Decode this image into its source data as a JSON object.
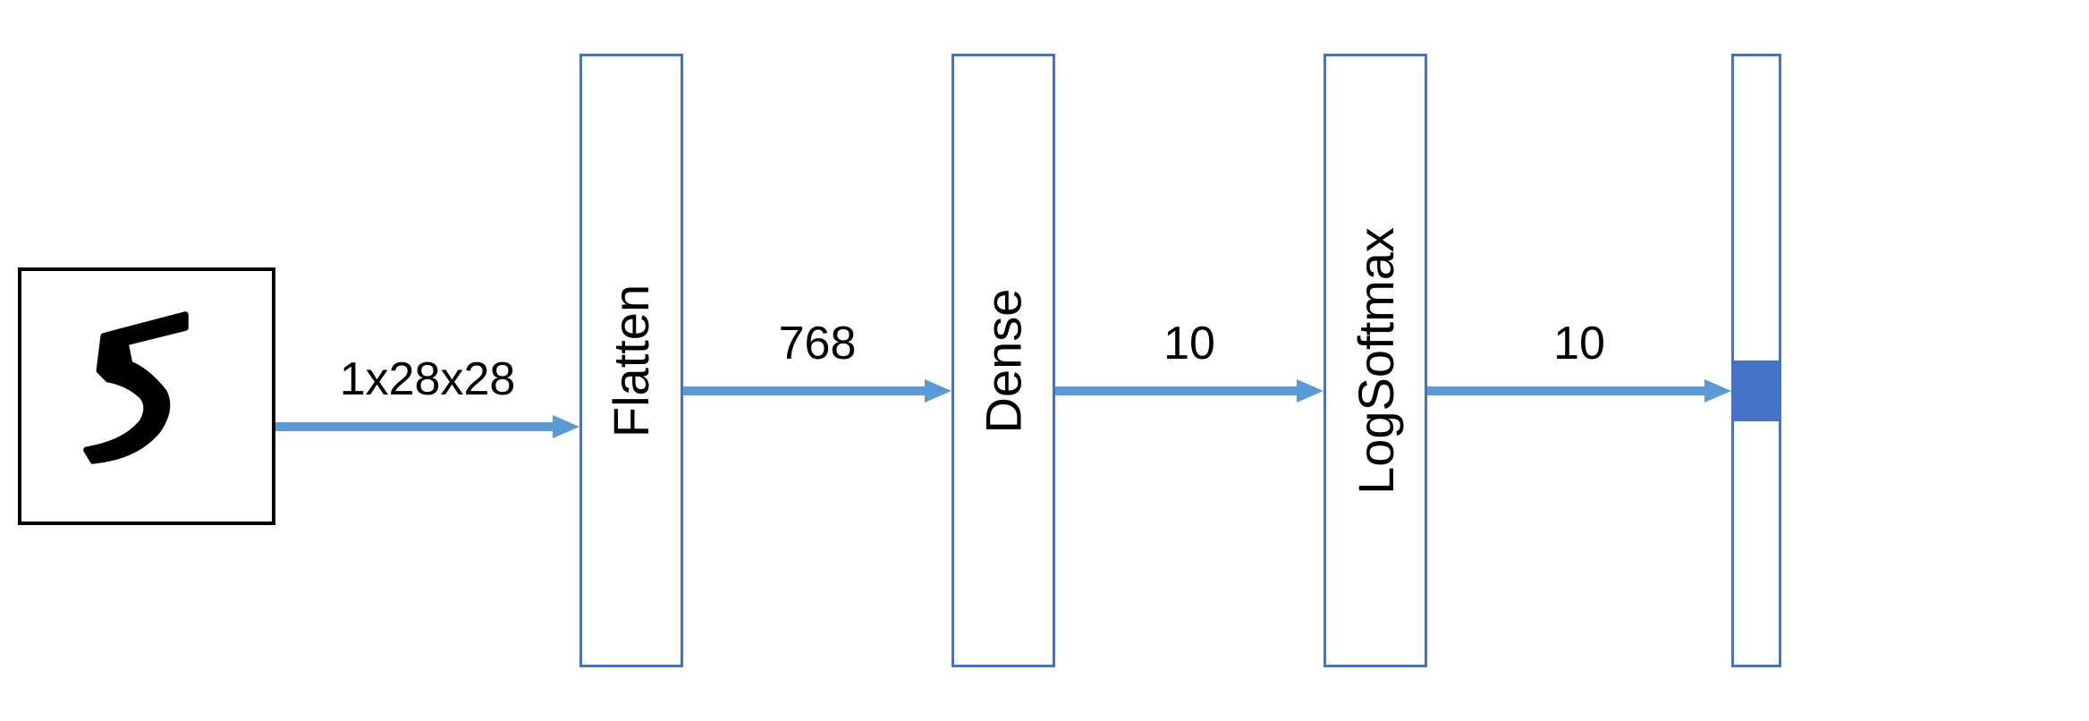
{
  "diagram": {
    "input": {
      "type": "handwritten-digit",
      "digit": "5"
    },
    "arrows": [
      {
        "label": "1x28x28"
      },
      {
        "label": "768"
      },
      {
        "label": "10"
      },
      {
        "label": "10"
      }
    ],
    "layers": [
      {
        "name": "Flatten"
      },
      {
        "name": "Dense"
      },
      {
        "name": "LogSoftmax"
      }
    ],
    "output": {
      "highlighted_index": 5,
      "total": 10
    },
    "colors": {
      "border": "#4472c4",
      "arrow": "#5b9bd5",
      "marker": "#4472c4"
    }
  }
}
